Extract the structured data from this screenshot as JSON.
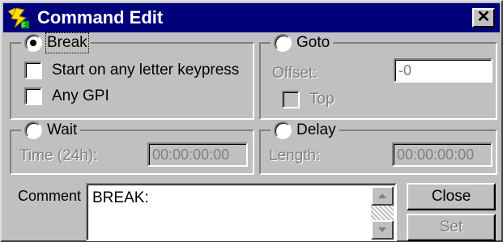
{
  "window": {
    "title": "Command Edit",
    "icon": "lightning-app-icon",
    "close_glyph": "✕"
  },
  "break_group": {
    "label": "Break",
    "selected": true,
    "start_on_keypress": {
      "label": "Start on any letter keypress",
      "checked": false
    },
    "any_gpi": {
      "label": "Any GPI",
      "checked": false
    }
  },
  "goto_group": {
    "label": "Goto",
    "selected": false,
    "offset": {
      "label": "Offset:",
      "value": "-0"
    },
    "top": {
      "label": "Top",
      "checked": false
    }
  },
  "wait_group": {
    "label": "Wait",
    "selected": false,
    "time": {
      "label": "Time (24h):",
      "value": "00:00:00:00"
    }
  },
  "delay_group": {
    "label": "Delay",
    "selected": false,
    "length": {
      "label": "Length:",
      "value": "00:00:00:00"
    }
  },
  "comment": {
    "label": "Comment",
    "value": "BREAK:"
  },
  "buttons": {
    "close": "Close",
    "set": "Set"
  }
}
